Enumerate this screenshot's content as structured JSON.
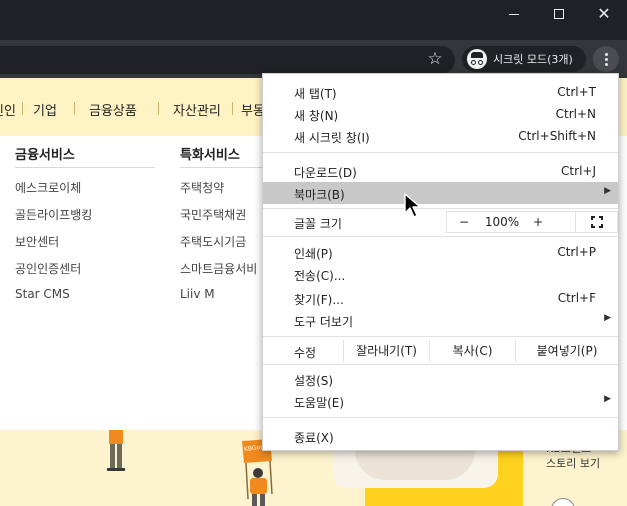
{
  "incognito": {
    "label": "시크릿 모드(3개)"
  },
  "window_controls": {
    "minimize": "minimize",
    "maximize": "maximize",
    "close": "✕"
  },
  "page": {
    "gnb": [
      {
        "label": "인인"
      },
      {
        "label": "기업"
      },
      {
        "label": "금융상품"
      },
      {
        "label": "자산관리"
      },
      {
        "label": "부동"
      }
    ],
    "columns": [
      {
        "title": "금융서비스",
        "links": [
          "에스크로이체",
          "골든라이프뱅킹",
          "보안센터",
          "공인인증센터",
          "Star CMS"
        ]
      },
      {
        "title": "특화서비스",
        "links": [
          "주택청약",
          "국민주택채권",
          "주택도시기금",
          "스마트금융서비",
          "Liiv M"
        ]
      }
    ],
    "banner": {
      "sign": "KBGoodJob",
      "brand_line1": "KB브랜드",
      "brand_line2": "스토리 보기"
    }
  },
  "menu": {
    "items_top": [
      {
        "label": "새 탭(T)",
        "shortcut": "Ctrl+T"
      },
      {
        "label": "새 창(N)",
        "shortcut": "Ctrl+N"
      },
      {
        "label": "새 시크릿 창(I)",
        "shortcut": "Ctrl+Shift+N"
      }
    ],
    "downloads": {
      "label": "다운로드(D)",
      "shortcut": "Ctrl+J"
    },
    "bookmarks": {
      "label": "북마크(B)"
    },
    "zoom": {
      "label": "글꼴 크기",
      "minus": "−",
      "value": "100%",
      "plus": "+"
    },
    "items_mid": [
      {
        "label": "인쇄(P)",
        "shortcut": "Ctrl+P"
      },
      {
        "label": "전송(C)...",
        "shortcut": ""
      },
      {
        "label": "찾기(F)...",
        "shortcut": "Ctrl+F"
      }
    ],
    "more_tools": {
      "label": "도구 더보기"
    },
    "edit": {
      "label": "수정",
      "cut": "잘라내기(T)",
      "copy": "복사(C)",
      "paste": "붙여넣기(P)"
    },
    "settings": {
      "label": "설정(S)"
    },
    "help": {
      "label": "도움말(E)"
    },
    "exit": {
      "label": "종료(X)"
    }
  }
}
